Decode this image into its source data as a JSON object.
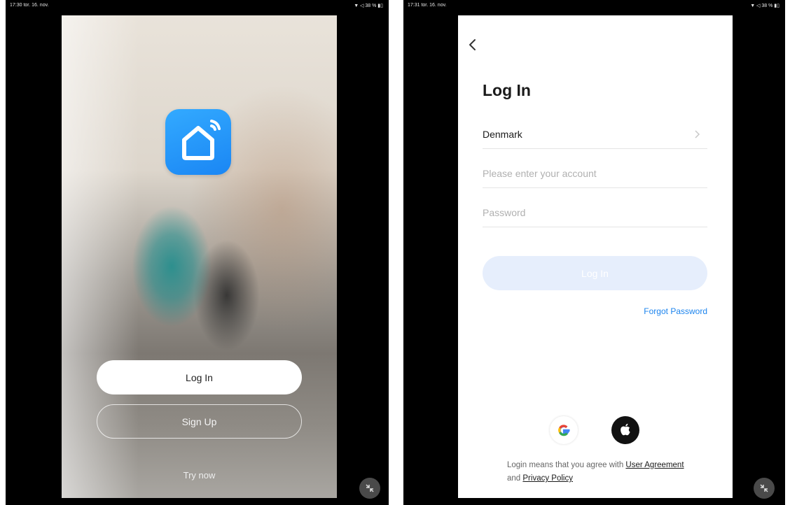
{
  "left": {
    "status": {
      "time": "17:30  tor. 16. nov.",
      "battery": "▼ ◁ 38 % ▮▯"
    },
    "app_icon": "smart-home-icon",
    "login_label": "Log In",
    "signup_label": "Sign Up",
    "try_now_label": "Try now",
    "corner_icon": "collapse-arrows-icon"
  },
  "right": {
    "status": {
      "time": "17:31  tor. 16. nov.",
      "battery": "▼ ◁ 38 % ▮▯"
    },
    "back_icon": "chevron-left-icon",
    "title": "Log In",
    "country": {
      "value": "Denmark",
      "icon": "chevron-right-icon"
    },
    "account": {
      "placeholder": "Please enter your account"
    },
    "password": {
      "placeholder": "Password"
    },
    "login_label": "Log In",
    "forgot_label": "Forgot Password",
    "social": {
      "google_icon": "google-icon",
      "apple_icon": "apple-icon"
    },
    "terms": {
      "prefix": "Login means that you agree with",
      "user_agreement": "User Agreement",
      "and": "and",
      "privacy_policy": "Privacy Policy"
    },
    "corner_icon": "collapse-arrows-icon"
  },
  "colors": {
    "accent": "#1c84ee",
    "login_disabled": "#e6eefc",
    "logo_blue": "#1a86f4"
  }
}
